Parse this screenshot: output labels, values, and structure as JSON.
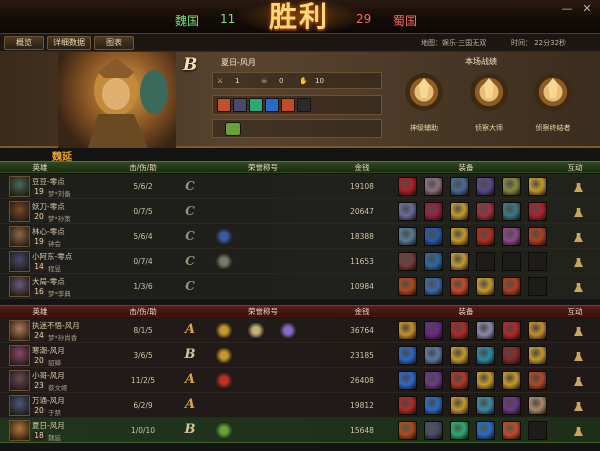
{
  "header": {
    "left_team": "魏国",
    "left_score": "11",
    "result_title": "胜利",
    "right_score": "29",
    "right_team": "蜀国",
    "colors": {
      "left": "#5ee05e",
      "right": "#e05050",
      "title": "#f6d878"
    }
  },
  "window_controls": {
    "close_icon": "✕",
    "minimize_icon": "—"
  },
  "tabs": [
    "概览",
    "详细数据",
    "图表"
  ],
  "match_info": {
    "map": "地图：娱乐·三国无双",
    "time": "时间：  22分32秒"
  },
  "player": {
    "rank": "B",
    "label": "夏日-风月",
    "hero_name": "魏延",
    "kills": "1",
    "deaths": "0",
    "assists": "10"
  },
  "battle_record": {
    "title": "本场战绩",
    "medals": [
      "神级辅助",
      "侦察大师",
      "侦察终结者"
    ]
  },
  "columns": {
    "hero": "英雄",
    "kda": "击/伤/助",
    "honor": "荣誉称号",
    "gold": "金钱",
    "equip": "装备",
    "interact": "互动"
  },
  "team_green": [
    {
      "name": "豆豆-零点",
      "level": "19",
      "hero": "梦*刘备",
      "kda": "5/6/2",
      "rank": "C",
      "honors": [],
      "gold": "19108",
      "avatar": "#4a6a5a",
      "equip": [
        "#b0202a",
        "#8a7080",
        "#4a6a9a",
        "#5a4a8a",
        "#8a8a3a",
        "#c49a2a"
      ]
    },
    {
      "name": "妖刀-零点",
      "level": "20",
      "hero": "梦*孙策",
      "kda": "0/7/5",
      "rank": "C",
      "honors": [],
      "gold": "20647",
      "avatar": "#7a4a2a",
      "equip": [
        "#6a6aa0",
        "#9a2040",
        "#c49a2a",
        "#a03040",
        "#3a7a8a",
        "#b0202a"
      ]
    },
    {
      "name": "林心-零点",
      "level": "19",
      "hero": "钟会",
      "kda": "5/6/4",
      "rank": "C",
      "honors": [
        "#3a5aa8"
      ],
      "gold": "18388",
      "avatar": "#8a6a4a",
      "equip": [
        "#5a7a9a",
        "#2a5aaa",
        "#c49a2a",
        "#b03020",
        "#8a4a8a",
        "#b04020"
      ]
    },
    {
      "name": "小阿东-零点",
      "level": "14",
      "hero": "程昱",
      "kda": "0/7/4",
      "rank": "C",
      "honors": [
        "#7a7a6a"
      ],
      "gold": "11653",
      "avatar": "#4a4a6a",
      "equip": [
        "#7a3a3a",
        "#2a6aaa",
        "#c49a2a",
        "#2a2a2a",
        "#2a2a2a",
        "#2a2a2a"
      ]
    },
    {
      "name": "大局-零点",
      "level": "16",
      "hero": "梦*李典",
      "kda": "1/3/6",
      "rank": "C",
      "honors": [],
      "gold": "10984",
      "avatar": "#6a5a7a",
      "equip": [
        "#b04a20",
        "#3a6aaa",
        "#c44a2a",
        "#c49a2a",
        "#b04020",
        "#2a2a2a"
      ]
    }
  ],
  "team_red": [
    {
      "name": "执迷不悟-风月",
      "level": "24",
      "hero": "梦*孙尚香",
      "kda": "8/1/5",
      "rank": "A",
      "honors": [
        "#c49a2a",
        "#c4b07a",
        "#8a6aca"
      ],
      "gold": "36764",
      "avatar": "#b07a5a",
      "equip": [
        "#c4902a",
        "#6a2a8a",
        "#b02a2a",
        "#8a8aaa",
        "#b02a2a",
        "#c4902a"
      ]
    },
    {
      "name": "寒潮-风月",
      "level": "20",
      "hero": "貂蝉",
      "kda": "3/6/5",
      "rank": "B",
      "honors": [
        "#c49a2a"
      ],
      "gold": "23185",
      "avatar": "#8a4a6a",
      "equip": [
        "#2a6aca",
        "#5a7aaa",
        "#c49a2a",
        "#2a8aaa",
        "#8a2a2a",
        "#c49a2a"
      ]
    },
    {
      "name": "小哥-风月",
      "level": "23",
      "hero": "蔡文姬",
      "kda": "11/2/5",
      "rank": "A",
      "honors": [
        "#c43020"
      ],
      "gold": "26408",
      "avatar": "#6a4a5a",
      "equip": [
        "#2a6aca",
        "#6a3a8a",
        "#b03a2a",
        "#c49a2a",
        "#c49a2a",
        "#b04a2a"
      ]
    },
    {
      "name": "万通-风月",
      "level": "20",
      "hero": "于禁",
      "kda": "6/2/9",
      "rank": "A",
      "honors": [],
      "gold": "19812",
      "avatar": "#4a5a7a",
      "equip": [
        "#b02a2a",
        "#2a6aca",
        "#c49a2a",
        "#3a8aaa",
        "#6a3a8a",
        "#aa8a6a"
      ]
    },
    {
      "name": "夏日-风月",
      "level": "18",
      "hero": "魏延",
      "kda": "1/0/10",
      "rank": "B",
      "honors": [
        "#6aa03a"
      ],
      "gold": "15648",
      "avatar": "#b07a3a",
      "equip": [
        "#b04a20",
        "#4a4a6a",
        "#2aaa7a",
        "#2a6aca",
        "#c44a2a",
        "#2a2a2a"
      ]
    }
  ]
}
